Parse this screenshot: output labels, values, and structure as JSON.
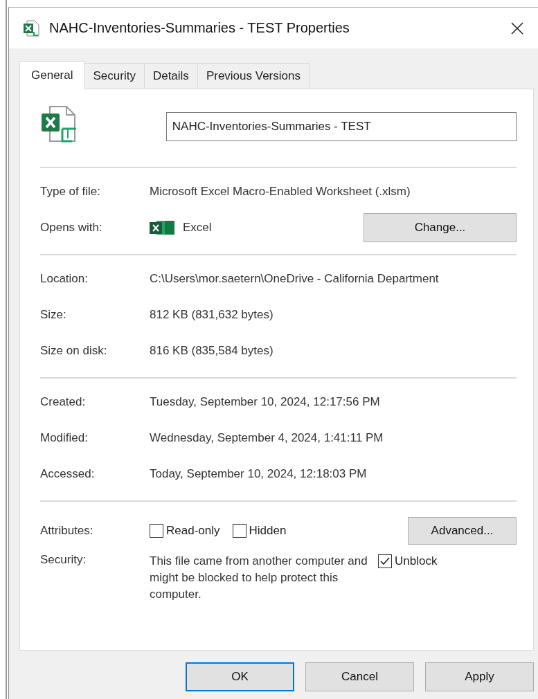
{
  "window": {
    "title": "NAHC-Inventories-Summaries - TEST Properties"
  },
  "tabs": [
    {
      "label": "General",
      "selected": true
    },
    {
      "label": "Security",
      "selected": false
    },
    {
      "label": "Details",
      "selected": false
    },
    {
      "label": "Previous Versions",
      "selected": false
    }
  ],
  "file_name": {
    "value": "NAHC-Inventories-Summaries - TEST"
  },
  "sections": [
    [
      {
        "kind": "text",
        "label": "Type of file:",
        "value": "Microsoft Excel Macro-Enabled Worksheet (.xlsm)"
      },
      {
        "kind": "app",
        "label": "Opens with:",
        "value": "Excel",
        "button": "Change..."
      }
    ],
    [
      {
        "kind": "text",
        "label": "Location:",
        "value": "C:\\Users\\mor.saetern\\OneDrive - California Department"
      },
      {
        "kind": "text",
        "label": "Size:",
        "value": "812 KB (831,632 bytes)"
      },
      {
        "kind": "text",
        "label": "Size on disk:",
        "value": "816 KB (835,584 bytes)"
      }
    ],
    [
      {
        "kind": "text",
        "label": "Created:",
        "value": "Tuesday, September 10, 2024, 12:17:56 PM"
      },
      {
        "kind": "text",
        "label": "Modified:",
        "value": "Wednesday, September 4, 2024, 1:41:11 PM"
      },
      {
        "kind": "text",
        "label": "Accessed:",
        "value": "Today, September 10, 2024, 12:18:03 PM"
      }
    ]
  ],
  "attributes": {
    "label": "Attributes:",
    "checks": [
      {
        "label": "Read-only",
        "checked": false
      },
      {
        "label": "Hidden",
        "checked": false
      }
    ],
    "button": "Advanced..."
  },
  "security": {
    "label": "Security:",
    "text": "This file came from another computer and might be blocked to help protect this computer.",
    "unblock": {
      "label": "Unblock",
      "checked": true
    }
  },
  "buttons": [
    {
      "label": "OK",
      "default": true
    },
    {
      "label": "Cancel",
      "default": false
    },
    {
      "label": "Apply",
      "default": false
    }
  ]
}
